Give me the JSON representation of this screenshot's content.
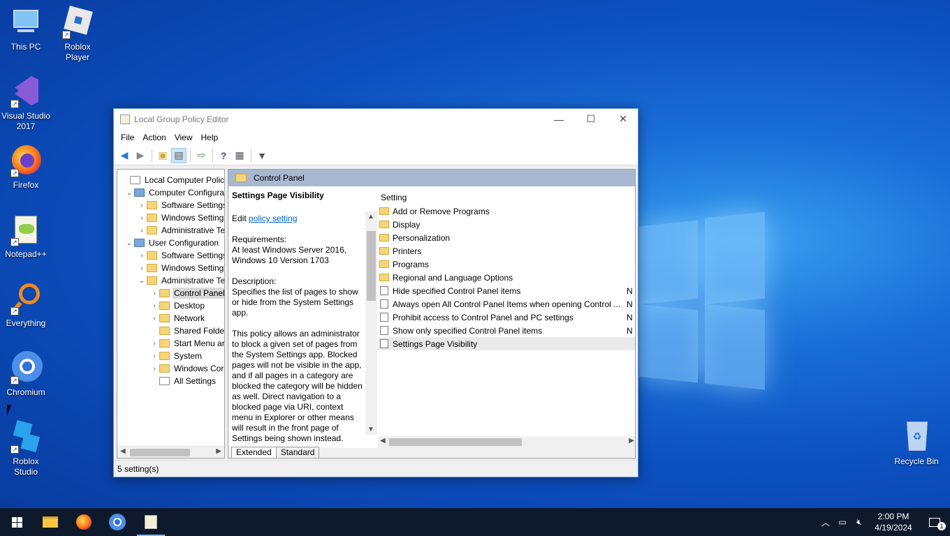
{
  "desktop": {
    "icons": [
      {
        "label": "This PC",
        "icon": "computer-icon"
      },
      {
        "label": "Roblox Player",
        "icon": "roblox-icon"
      },
      {
        "label": "Visual Studio 2017",
        "icon": "visual-studio-icon"
      },
      {
        "label": "Firefox",
        "icon": "firefox-icon"
      },
      {
        "label": "Notepad++",
        "icon": "notepadpp-icon"
      },
      {
        "label": "Everything",
        "icon": "everything-search-icon"
      },
      {
        "label": "Chromium",
        "icon": "chromium-icon"
      },
      {
        "label": "Roblox Studio",
        "icon": "roblox-studio-icon"
      },
      {
        "label": "Recycle Bin",
        "icon": "recycle-bin-icon"
      }
    ]
  },
  "window": {
    "title": "Local Group Policy Editor",
    "menu": [
      "File",
      "Action",
      "View",
      "Help"
    ],
    "tree": [
      {
        "label": "Local Computer Policy",
        "chev": ""
      },
      {
        "label": "Computer Configura",
        "chev": "v"
      },
      {
        "label": "Software Settings",
        "chev": ">"
      },
      {
        "label": "Windows Setting",
        "chev": ">"
      },
      {
        "label": "Administrative Te",
        "chev": ">"
      },
      {
        "label": "User Configuration",
        "chev": "v"
      },
      {
        "label": "Software Settings",
        "chev": ">"
      },
      {
        "label": "Windows Setting",
        "chev": ">"
      },
      {
        "label": "Administrative Te",
        "chev": "v"
      },
      {
        "label": "Control Panel",
        "chev": ">"
      },
      {
        "label": "Desktop",
        "chev": ">"
      },
      {
        "label": "Network",
        "chev": ">"
      },
      {
        "label": "Shared Folder",
        "chev": ""
      },
      {
        "label": "Start Menu ar",
        "chev": ">"
      },
      {
        "label": "System",
        "chev": ">"
      },
      {
        "label": "Windows Cor",
        "chev": ">"
      },
      {
        "label": "All Settings",
        "chev": ""
      }
    ],
    "pane_header": "Control Panel",
    "description": {
      "title": "Settings Page Visibility",
      "edit_prefix": "Edit",
      "edit_link": "policy setting",
      "requirements_label": "Requirements:",
      "requirements": "At least Windows Server 2016, Windows 10 Version 1703",
      "description_label": "Description:",
      "description": "Specifies the list of pages to show or hide from the System Settings app.",
      "details": "This policy allows an administrator to block a given set of pages from the System Settings app. Blocked pages will not be visible in the app, and if all pages in a category are blocked the category will be hidden as well. Direct navigation to a blocked page via URI, context menu in Explorer or other means will result in the front page of Settings being shown instead."
    },
    "list_header": "Setting",
    "list": [
      {
        "name": "Add or Remove Programs",
        "type": "folder",
        "state": ""
      },
      {
        "name": "Display",
        "type": "folder",
        "state": ""
      },
      {
        "name": "Personalization",
        "type": "folder",
        "state": ""
      },
      {
        "name": "Printers",
        "type": "folder",
        "state": ""
      },
      {
        "name": "Programs",
        "type": "folder",
        "state": ""
      },
      {
        "name": "Regional and Language Options",
        "type": "folder",
        "state": ""
      },
      {
        "name": "Hide specified Control Panel items",
        "type": "policy",
        "state": "N"
      },
      {
        "name": "Always open All Control Panel Items when opening Control ...",
        "type": "policy",
        "state": "N"
      },
      {
        "name": "Prohibit access to Control Panel and PC settings",
        "type": "policy",
        "state": "N"
      },
      {
        "name": "Show only specified Control Panel items",
        "type": "policy",
        "state": "N"
      },
      {
        "name": "Settings Page Visibility",
        "type": "policy",
        "state": ""
      }
    ],
    "tabs": [
      "Extended",
      "Standard"
    ],
    "status": "5 setting(s)"
  },
  "taskbar": {
    "time": "2:00 PM",
    "date": "4/19/2024",
    "notifications": "1"
  }
}
